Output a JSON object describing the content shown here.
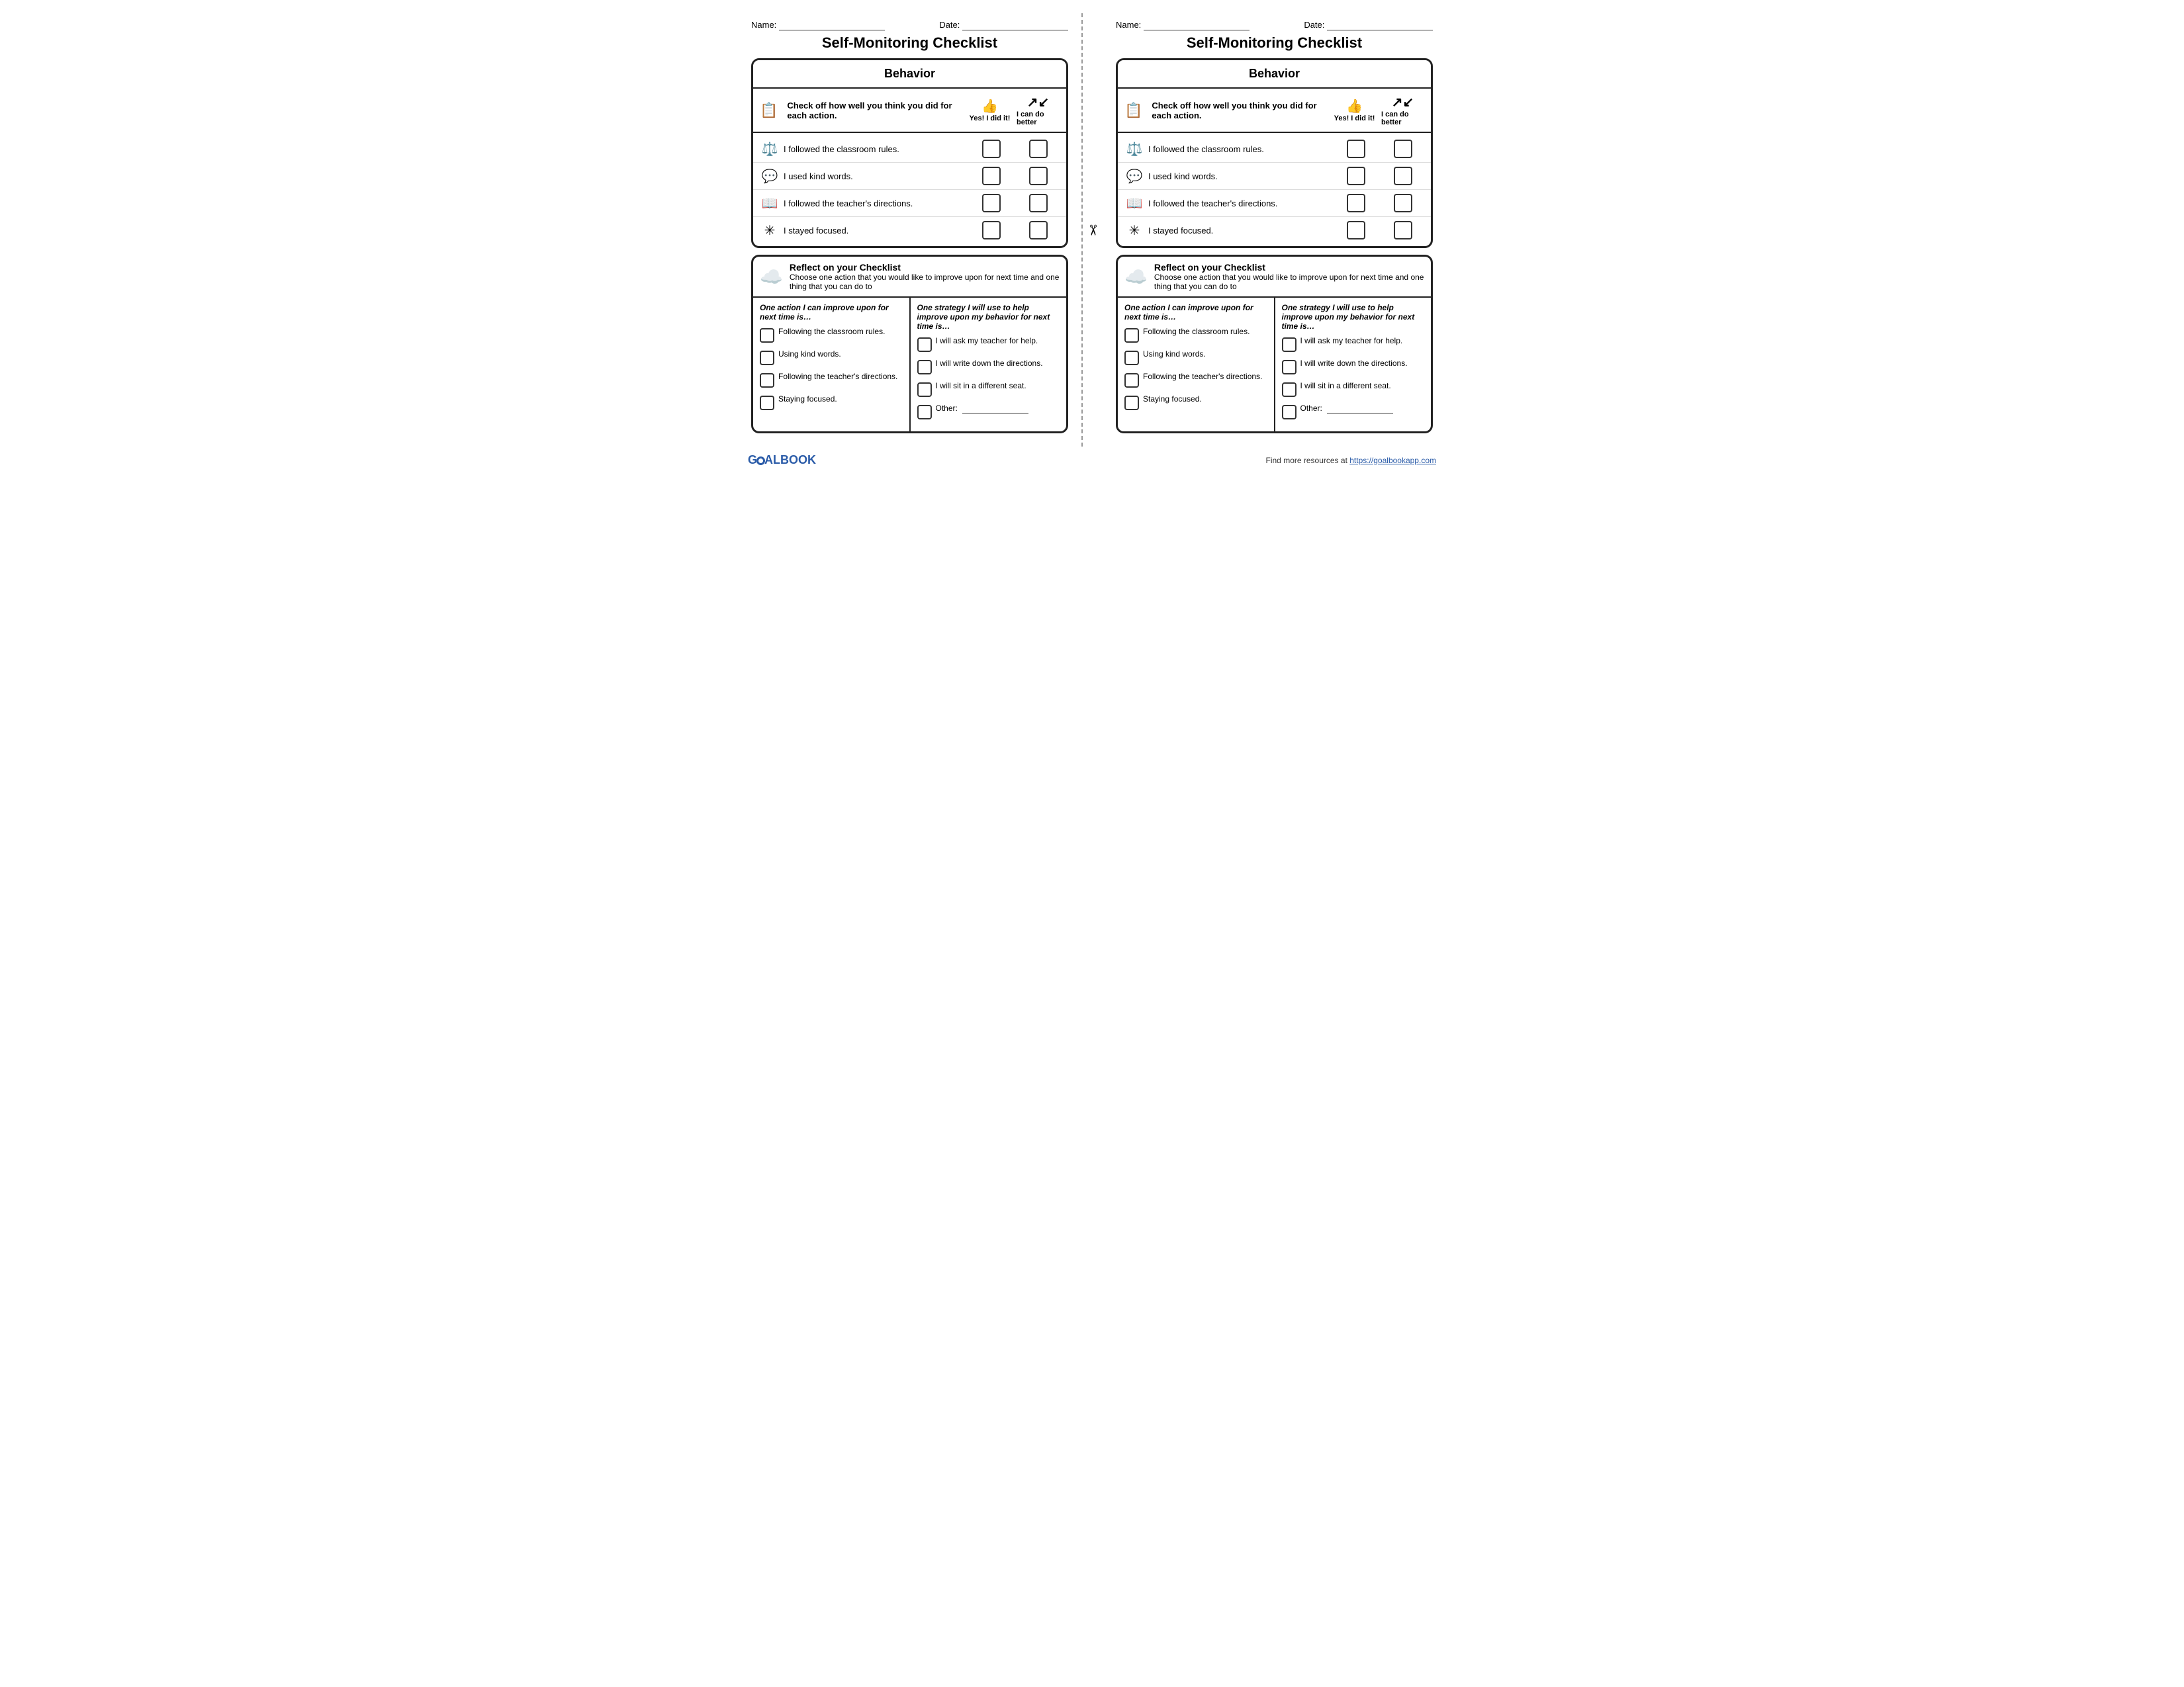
{
  "sheets": [
    {
      "id": "left",
      "name_label": "Name:",
      "name_underline": "________________________",
      "date_label": "Date:",
      "date_underline": "____________",
      "title": "Self-Monitoring Checklist",
      "behavior_header": "Behavior",
      "check_instructions": "Check off how well you think you did for each action.",
      "yes_label": "Yes! I did it!",
      "cando_label": "I can do better",
      "behaviors": [
        {
          "icon": "⚖",
          "text": "I followed  the classroom rules."
        },
        {
          "icon": "💬",
          "text": "I used kind words."
        },
        {
          "icon": "📖",
          "text": "I followed  the teacher's directions."
        },
        {
          "icon": "✳",
          "text": "I stayed focused."
        }
      ],
      "reflect_title": "Reflect on your Checklist",
      "reflect_desc": "Choose one action that you would like to improve upon for next time and one thing that you can do to",
      "col1_title": "One action I can improve upon for next time is…",
      "col1_items": [
        "Following the classroom rules.",
        "Using kind words.",
        "Following the teacher's directions.",
        "Staying focused."
      ],
      "col2_title": "One strategy I will use to help improve upon my behavior for next time is…",
      "col2_items": [
        "I will ask my teacher for help.",
        "I will write down the directions.",
        "I will sit in a different seat.",
        "Other: "
      ]
    },
    {
      "id": "right",
      "name_label": "Name:",
      "name_underline": "________________________",
      "date_label": "Date:",
      "date_underline": "____________",
      "title": "Self-Monitoring Checklist",
      "behavior_header": "Behavior",
      "check_instructions": "Check off how well you think you did for each action.",
      "yes_label": "Yes! I did it!",
      "cando_label": "I can do better",
      "behaviors": [
        {
          "icon": "⚖",
          "text": "I followed  the classroom rules."
        },
        {
          "icon": "💬",
          "text": "I used kind words."
        },
        {
          "icon": "📖",
          "text": "I followed  the teacher's directions."
        },
        {
          "icon": "✳",
          "text": "I stayed focused."
        }
      ],
      "reflect_title": "Reflect on your Checklist",
      "reflect_desc": "Choose one action that you would like to improve upon for next time and one thing that you can do to",
      "col1_title": "One action I can improve upon for next time is…",
      "col1_items": [
        "Following the classroom rules.",
        "Using kind words.",
        "Following the teacher's directions.",
        "Staying focused."
      ],
      "col2_title": "One strategy I will use to help improve upon my behavior for next time is…",
      "col2_items": [
        "I will ask my teacher for help.",
        "I will write down the directions.",
        "I will sit in a different seat.",
        "Other: "
      ]
    }
  ],
  "footer": {
    "logo_text": "GOALBOOK",
    "find_more": "Find more resources at ",
    "link_text": "https://goalbookapp.com",
    "link_url": "https://goalbookapp.com"
  }
}
